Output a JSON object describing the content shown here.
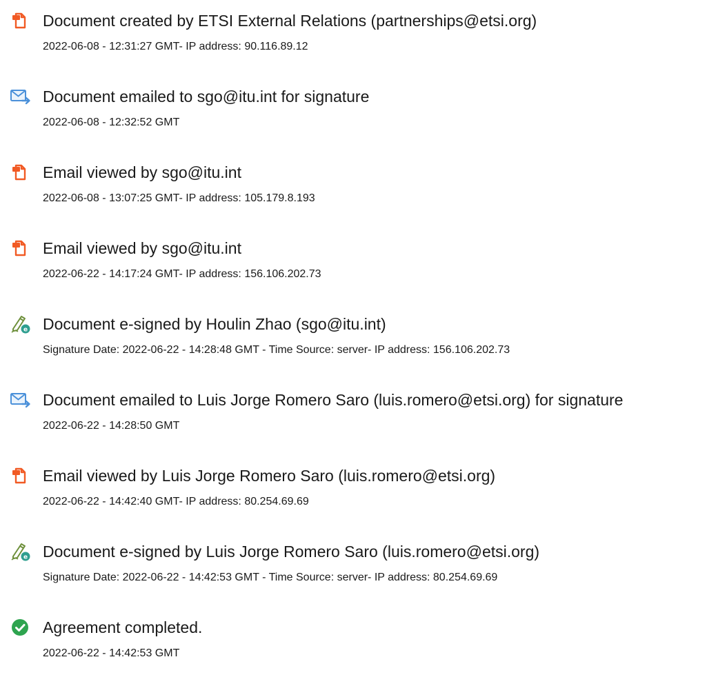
{
  "entries": [
    {
      "icon": "document-icon",
      "title": "Document created by ETSI External Relations (partnerships@etsi.org)",
      "detail": "2022-06-08 - 12:31:27 GMT- IP address: 90.116.89.12"
    },
    {
      "icon": "email-send-icon",
      "title": "Document emailed to sgo@itu.int for signature",
      "detail": "2022-06-08 - 12:32:52 GMT"
    },
    {
      "icon": "document-icon",
      "title": "Email viewed by sgo@itu.int",
      "detail": "2022-06-08 - 13:07:25 GMT- IP address: 105.179.8.193"
    },
    {
      "icon": "document-icon",
      "title": "Email viewed by sgo@itu.int",
      "detail": "2022-06-22 - 14:17:24 GMT- IP address: 156.106.202.73"
    },
    {
      "icon": "esign-pen-icon",
      "title": "Document e-signed by Houlin Zhao (sgo@itu.int)",
      "detail": "Signature Date: 2022-06-22 - 14:28:48 GMT - Time Source: server- IP address: 156.106.202.73"
    },
    {
      "icon": "email-send-icon",
      "title": "Document emailed to Luis Jorge Romero Saro (luis.romero@etsi.org) for signature",
      "detail": "2022-06-22 - 14:28:50 GMT"
    },
    {
      "icon": "document-icon",
      "title": "Email viewed by Luis Jorge Romero Saro (luis.romero@etsi.org)",
      "detail": "2022-06-22 - 14:42:40 GMT- IP address: 80.254.69.69"
    },
    {
      "icon": "esign-pen-icon",
      "title": "Document e-signed by Luis Jorge Romero Saro (luis.romero@etsi.org)",
      "detail": "Signature Date: 2022-06-22 - 14:42:53 GMT - Time Source: server- IP address: 80.254.69.69"
    },
    {
      "icon": "checkmark-circle-icon",
      "title": "Agreement completed.",
      "detail": "2022-06-22 - 14:42:53 GMT"
    }
  ],
  "colors": {
    "document_icon": "#f15a24",
    "email_icon": "#4a90d9",
    "esign_icon": "#2e9e8f",
    "check_icon": "#2ea44f"
  }
}
